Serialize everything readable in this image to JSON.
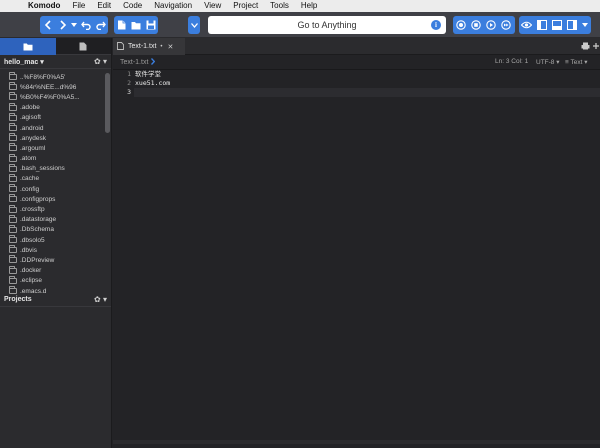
{
  "menubar": {
    "apple": "",
    "app_name": "Komodo",
    "items": [
      "File",
      "Edit",
      "Code",
      "Navigation",
      "View",
      "Project",
      "Tools",
      "Help"
    ]
  },
  "toolbar": {
    "goto_label": "Go to Anything",
    "goto_info": "i",
    "accent_color": "#3b7ede",
    "icons_left": [
      "back-arrow-icon",
      "forward-arrow-icon",
      "history-dropdown-icon",
      "undo-icon",
      "redo-icon",
      "new-file-icon",
      "open-folder-icon",
      "save-icon",
      "menu-dropdown-icon"
    ],
    "icons_right": [
      "record-macro-icon",
      "stop-macro-icon",
      "play-macro-icon",
      "replay-macro-icon",
      "eye-icon",
      "left-pane-icon",
      "bottom-pane-icon",
      "right-pane-icon",
      "more-dropdown-icon"
    ]
  },
  "sidebar": {
    "places_title": "hello_mac",
    "places_title_caret": "▾",
    "gear": "✿ ▾",
    "items": [
      "..%F8%F0%A5'",
      "%84r%NEE...d%96",
      "%B0%F4%F0%A5...",
      ".adobe",
      ".agisoft",
      ".android",
      ".anydesk",
      ".argouml",
      ".atom",
      ".bash_sessions",
      ".cache",
      ".config",
      ".configprops",
      ".crossftp",
      ".datastorage",
      ".DbSchema",
      ".dbsolo5",
      ".dbvis",
      ".DDPreview",
      ".docker",
      ".eclipse",
      ".emacs.d"
    ],
    "projects_title": "Projects"
  },
  "editor": {
    "tab_label": "Text-1.txt",
    "tab_dirty": "•",
    "tab_close": "✕",
    "breadcrumb": "Text-1.txt",
    "position": "Ln: 3 Col: 1",
    "encoding": "UTF-8 ▾",
    "language": "Text ▾",
    "language_icon": "≡",
    "line_numbers": [
      "1",
      "2",
      "3"
    ],
    "lines": [
      "软件学堂",
      "xue51.com",
      ""
    ]
  }
}
